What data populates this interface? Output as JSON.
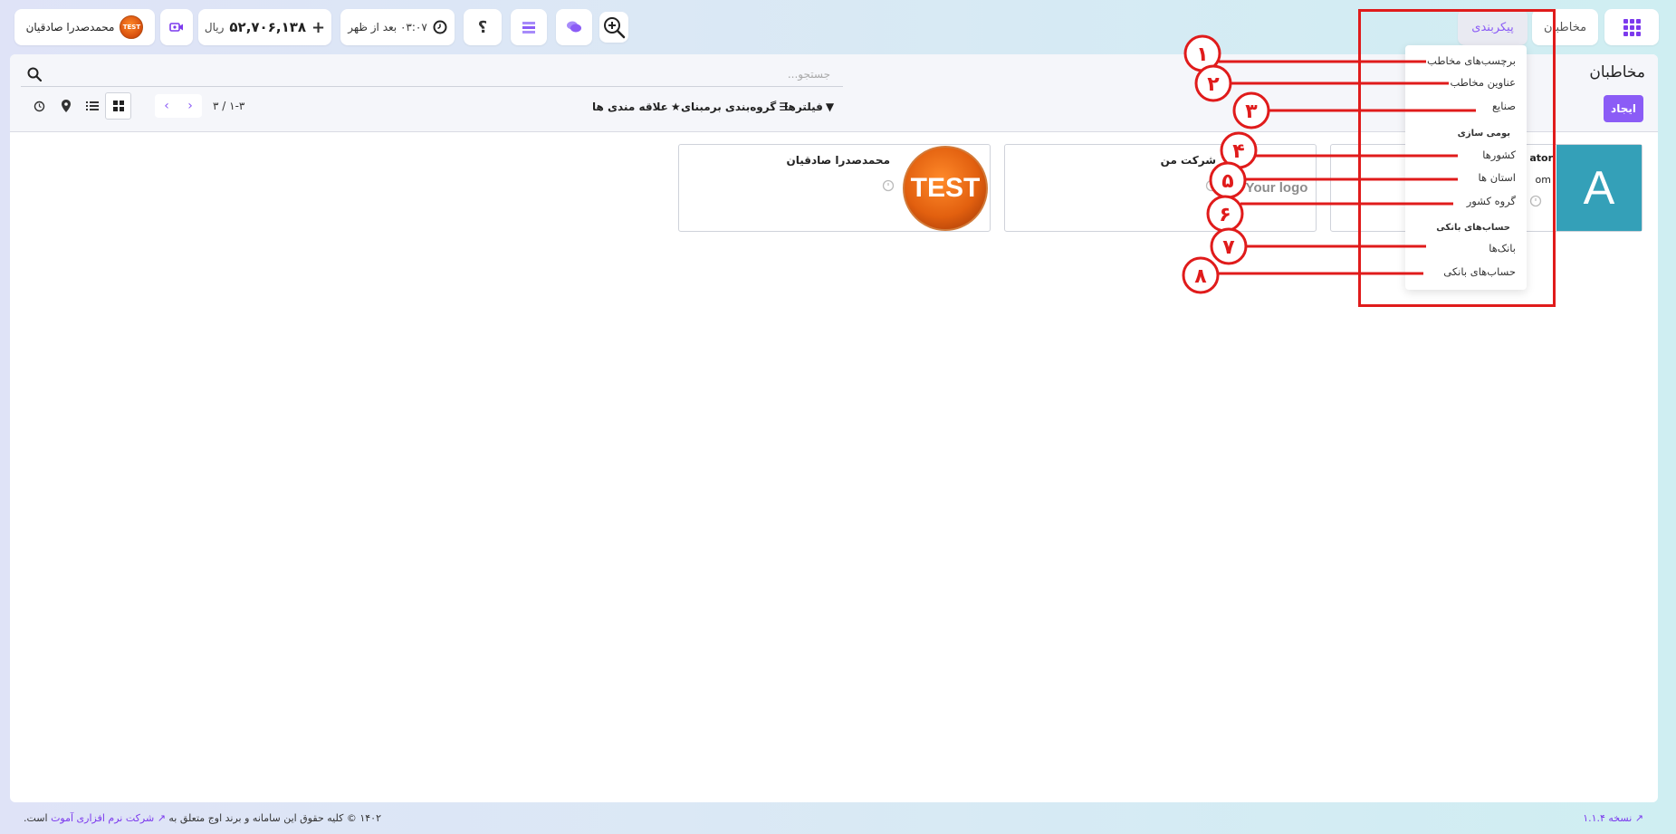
{
  "topbar": {
    "nav_contacts": "مخاطبان",
    "nav_config": "پیکربندی",
    "time": "۰۳:۰۷ بعد از ظهر",
    "balance_plus": "+",
    "balance_amount": "۵۲,۷۰۶,۱۳۸",
    "balance_unit": "ریال",
    "help": "؟",
    "user_name": "محمدصدرا صادقیان",
    "avatar_text": "TEST",
    "icons": [
      "apps-grid-icon",
      "zoom-in-icon",
      "chat-icon",
      "list-icon",
      "clock-icon",
      "video-icon"
    ]
  },
  "control_panel": {
    "title": "مخاطبان",
    "create_label": "ایجاد",
    "search_placeholder": "جستجو...",
    "filters_label": "فیلترها",
    "group_by_label": "گروه‌بندی برمبنای",
    "favorites_label": "علاقه مندی ها",
    "pager_text": "۱-۳ / ۳",
    "views": [
      "kanban",
      "list",
      "map",
      "activity"
    ]
  },
  "cards": [
    {
      "name": "محمدصدرا صادقیان",
      "image_text": "TEST"
    },
    {
      "name": "شرکت من",
      "image_text": "Your logo"
    },
    {
      "name_partial": "ator",
      "email_partial": "om",
      "avatar_letter": "A"
    }
  ],
  "config_menu": {
    "items": [
      {
        "label": "برچسب‌های مخاطب",
        "number": "۱"
      },
      {
        "label": "عناوین مخاطب",
        "number": "۲"
      },
      {
        "label": "صنایع",
        "number": "۳"
      }
    ],
    "localization_header": "بومی سازی",
    "localization_items": [
      {
        "label": "کشورها",
        "number": "۴"
      },
      {
        "label": "استان ها",
        "number": "۵"
      },
      {
        "label": "گروه کشور",
        "number": "۶"
      }
    ],
    "bank_header": "حساب‌های بانکی",
    "bank_items": [
      {
        "label": "بانک‌ها",
        "number": "۷"
      },
      {
        "label": "حساب‌های بانکی",
        "number": "۸"
      }
    ]
  },
  "annotation": {
    "color": "#e01b1b"
  },
  "footer": {
    "copyright_prefix": "۱۴۰۲ © کلیه حقوق این سامانه و برند اوج متعلق به",
    "company_link": "شرکت نرم افزاری آموت",
    "copyright_suffix": "است.",
    "version": "نسخه ۱.۱.۴"
  },
  "colors": {
    "accent": "#8b5cf6",
    "annotation": "#e01b1b",
    "avatar_bg": "#34a0b8"
  }
}
